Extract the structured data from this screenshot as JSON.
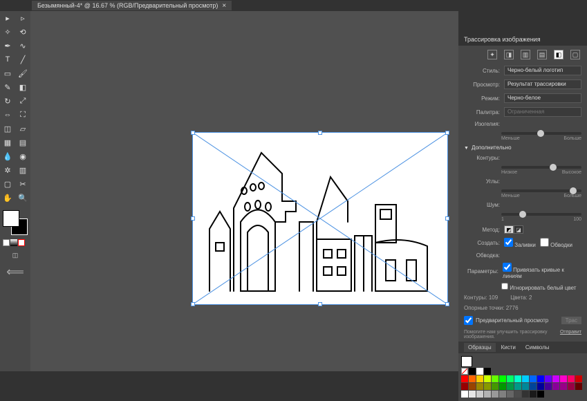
{
  "tab": {
    "title": "Безымянный-4* @ 16.67 % (RGB/Предварительный просмотр)"
  },
  "panel": {
    "title": "Трассировка изображения",
    "style_lbl": "Стиль:",
    "style_val": "Черно-белый логотип",
    "view_lbl": "Просмотр:",
    "view_val": "Результат трассировки",
    "mode_lbl": "Режим:",
    "mode_val": "Черно-белое",
    "palette_lbl": "Палитра:",
    "palette_val": "Ограниченная",
    "threshold_lbl": "Изогелия:",
    "thresh_min": "Меньше",
    "thresh_max": "Больше",
    "advanced": "Дополнительно",
    "paths_lbl": "Контуры:",
    "paths_min": "Низкое",
    "paths_max": "Высокое",
    "corners_lbl": "Углы:",
    "corners_min": "Меньше",
    "corners_max": "Больше",
    "noise_lbl": "Шум:",
    "noise_min": "1",
    "noise_max": "100",
    "method_lbl": "Метод:",
    "create_lbl": "Создать:",
    "fills": "Заливки",
    "strokes": "Обводки",
    "stroke_lbl": "Обводка:",
    "options_lbl": "Параметры:",
    "snap": "Привязать кривые к линиям",
    "ignore_white": "Игнорировать белый цвет",
    "paths_cnt_lbl": "Контуры:",
    "paths_cnt": "109",
    "colors_lbl": "Цвета:",
    "colors_cnt": "2",
    "anchors_lbl": "Опорные точки:",
    "anchors_cnt": "2776",
    "preview": "Предварительный просмотр",
    "trace_btn": "Трас",
    "help_txt": "Помогите нам улучшить трассировку изображения.",
    "help_link": "Отправит"
  },
  "bottom_tabs": {
    "swatches": "Образцы",
    "brushes": "Кисти",
    "symbols": "Символы"
  },
  "palette": {
    "row1": [
      "#ff0000",
      "#ff6600",
      "#ffcc00",
      "#ccff00",
      "#66ff00",
      "#00ff00",
      "#00ff66",
      "#00ffcc",
      "#00ccff",
      "#0066ff",
      "#0000ff",
      "#6600ff",
      "#cc00ff",
      "#ff00cc",
      "#ff0066",
      "#cc0000"
    ],
    "row2": [
      "#990000",
      "#994400",
      "#998800",
      "#889900",
      "#449900",
      "#009900",
      "#009944",
      "#009988",
      "#008899",
      "#004499",
      "#000099",
      "#440099",
      "#880099",
      "#990088",
      "#990044",
      "#660000"
    ],
    "grays": [
      "#ffffff",
      "#e6e6e6",
      "#cccccc",
      "#b3b3b3",
      "#999999",
      "#808080",
      "#666666",
      "#4d4d4d",
      "#333333",
      "#1a1a1a",
      "#000000"
    ]
  }
}
